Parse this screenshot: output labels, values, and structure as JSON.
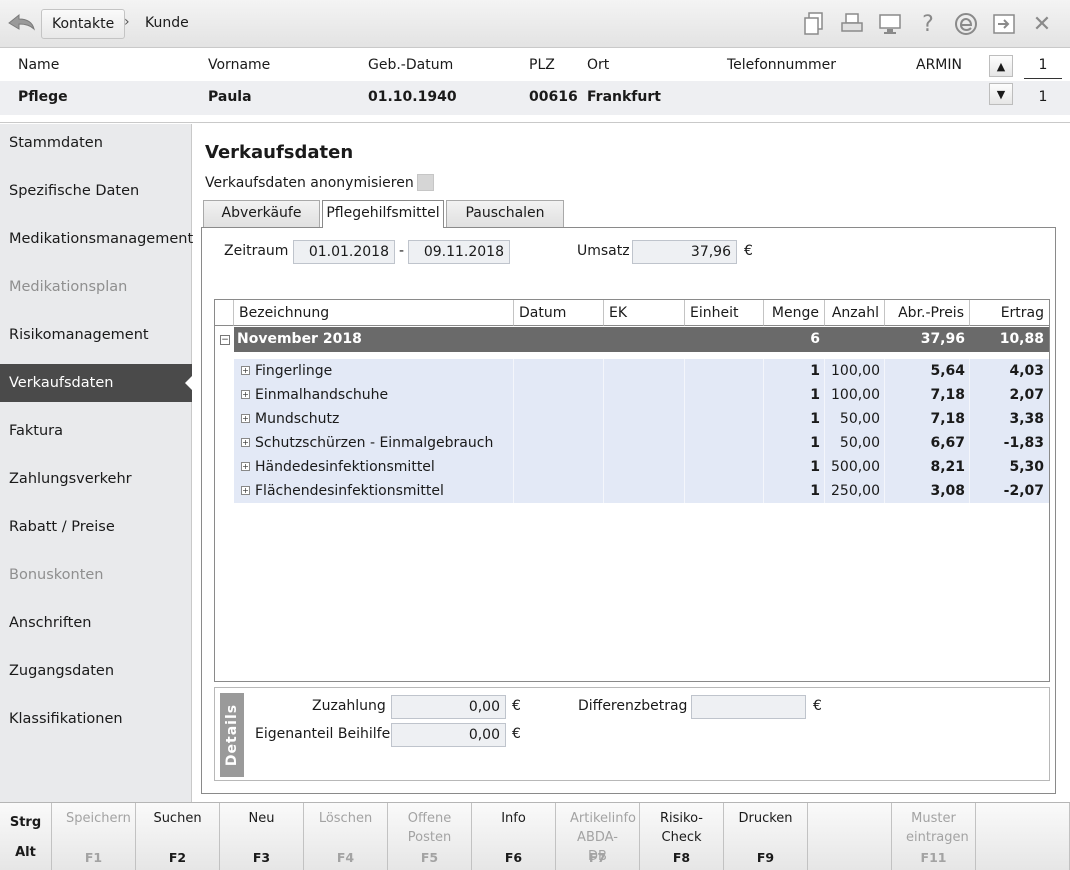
{
  "breadcrumb": {
    "parent": "Kontakte",
    "separator": "›",
    "current": "Kunde"
  },
  "toolbar_icons": [
    "documents-icon",
    "print-icon",
    "monitor-icon",
    "help-icon",
    "edge-icon",
    "export-icon",
    "close-icon"
  ],
  "toolbar_glyphs": {
    "help": "?",
    "close": "✕"
  },
  "customer": {
    "headers": {
      "name": "Name",
      "vorname": "Vorname",
      "geburtsdatum": "Geb.-Datum",
      "plz": "PLZ",
      "ort": "Ort",
      "telefon": "Telefonnummer",
      "user": "ARMIN"
    },
    "values": {
      "name": "Pflege",
      "vorname": "Paula",
      "geburtsdatum": "01.10.1940",
      "plz": "00616",
      "ort": "Frankfurt",
      "telefon": ""
    },
    "counter_top": "1",
    "counter_bottom": "1"
  },
  "sidebar": {
    "items": [
      {
        "label": "Stammdaten",
        "state": "normal"
      },
      {
        "label": "Spezifische Daten",
        "state": "normal"
      },
      {
        "label": "Medikationsmanagement",
        "state": "normal"
      },
      {
        "label": "Medikationsplan",
        "state": "disabled"
      },
      {
        "label": "Risikomanagement",
        "state": "normal"
      },
      {
        "label": "Verkaufsdaten",
        "state": "active"
      },
      {
        "label": "Faktura",
        "state": "normal"
      },
      {
        "label": "Zahlungsverkehr",
        "state": "normal"
      },
      {
        "label": "Rabatt / Preise",
        "state": "normal"
      },
      {
        "label": "Bonuskonten",
        "state": "disabled"
      },
      {
        "label": "Anschriften",
        "state": "normal"
      },
      {
        "label": "Zugangsdaten",
        "state": "normal"
      },
      {
        "label": "Klassifikationen",
        "state": "normal"
      }
    ]
  },
  "main": {
    "title": "Verkaufsdaten",
    "anonymize_label": "Verkaufsdaten anonymisieren",
    "tabs": [
      {
        "label": "Abverkäufe",
        "active": false
      },
      {
        "label": "Pflegehilfsmittel",
        "active": true
      },
      {
        "label": "Pauschalen",
        "active": false
      }
    ],
    "zeitraum_label": "Zeitraum",
    "date_from": "01.01.2018",
    "date_sep": "-",
    "date_to": "09.11.2018",
    "umsatz_label": "Umsatz",
    "umsatz_value": "37,96",
    "currency": "€",
    "grid": {
      "columns": [
        "Bezeichnung",
        "Datum",
        "EK (Brutto)",
        "Einheit",
        "Menge",
        "Anzahl",
        "Abr.-Preis",
        "Ertrag"
      ],
      "group": {
        "toggle": "−",
        "label": "November 2018",
        "menge": "6",
        "abr_preis": "37,96",
        "ertrag": "10,88"
      },
      "row_toggle": "+",
      "rows": [
        {
          "bezeichnung": "Fingerlinge",
          "menge": "1",
          "anzahl": "100,00",
          "abr_preis": "5,64",
          "ertrag": "4,03"
        },
        {
          "bezeichnung": "Einmalhandschuhe",
          "menge": "1",
          "anzahl": "100,00",
          "abr_preis": "7,18",
          "ertrag": "2,07"
        },
        {
          "bezeichnung": "Mundschutz",
          "menge": "1",
          "anzahl": "50,00",
          "abr_preis": "7,18",
          "ertrag": "3,38"
        },
        {
          "bezeichnung": "Schutzschürzen - Einmalgebrauch",
          "menge": "1",
          "anzahl": "50,00",
          "abr_preis": "6,67",
          "ertrag": "-1,83"
        },
        {
          "bezeichnung": "Händedesinfektionsmittel",
          "menge": "1",
          "anzahl": "500,00",
          "abr_preis": "8,21",
          "ertrag": "5,30"
        },
        {
          "bezeichnung": "Flächendesinfektionsmittel",
          "menge": "1",
          "anzahl": "250,00",
          "abr_preis": "3,08",
          "ertrag": "-2,07"
        }
      ]
    },
    "details": {
      "tab_label": "Details",
      "zuzahlung_label": "Zuzahlung",
      "zuzahlung_value": "0,00",
      "eigenanteil_label": "Eigenanteil Beihilfe",
      "eigenanteil_value": "0,00",
      "differenz_label": "Differenzbetrag",
      "differenz_value": ""
    }
  },
  "function_bar": {
    "modifiers": {
      "strg": "Strg",
      "alt": "Alt"
    },
    "keys": [
      {
        "label": "Speichern",
        "key": "F1",
        "enabled": false
      },
      {
        "label": "Suchen",
        "key": "F2",
        "enabled": true
      },
      {
        "label": "Neu",
        "key": "F3",
        "enabled": true
      },
      {
        "label": "Löschen",
        "key": "F4",
        "enabled": false
      },
      {
        "label": "Offene Posten",
        "key": "F5",
        "enabled": false
      },
      {
        "label": "Info",
        "key": "F6",
        "enabled": true
      },
      {
        "label": "Artikelinfo ABDA-DB",
        "key": "F7",
        "enabled": false
      },
      {
        "label": "Risiko-Check",
        "key": "F8",
        "enabled": true
      },
      {
        "label": "Drucken",
        "key": "F9",
        "enabled": true
      },
      {
        "label": "",
        "key": "",
        "enabled": false
      },
      {
        "label": "Muster eintragen",
        "key": "F11",
        "enabled": false
      },
      {
        "label": "",
        "key": "",
        "enabled": false
      }
    ]
  }
}
